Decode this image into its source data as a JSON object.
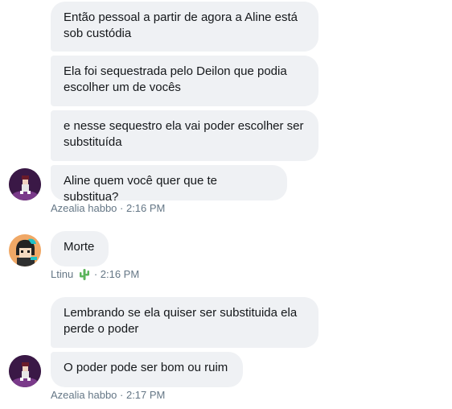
{
  "messages": [
    {
      "text": "Então pessoal a partir de agora a Aline está sob custódia"
    },
    {
      "text": "Ela foi sequestrada pelo Deilon que podia escolher um de vocês"
    },
    {
      "text": "e nesse sequestro ela vai poder escolher ser substituída"
    },
    {
      "text": "Aline quem você quer que te substitua?"
    },
    {
      "text": "Morte"
    },
    {
      "text": "Lembrando se ela quiser ser substituida ela perde o poder"
    },
    {
      "text": "O poder pode ser bom ou ruim"
    }
  ],
  "meta": [
    {
      "sender": "Azealia habbo",
      "sep": " · ",
      "time": "2:16 PM"
    },
    {
      "sender": "Ltinu",
      "emoji": "cactus-icon",
      "sep": " · ",
      "time": "2:16 PM"
    },
    {
      "sender": "Azealia habbo",
      "sep": " · ",
      "time": "2:17 PM"
    }
  ],
  "colors": {
    "bubble_bg": "#eff1f4",
    "meta_text": "#657786",
    "cactus": "#5ab45a"
  }
}
